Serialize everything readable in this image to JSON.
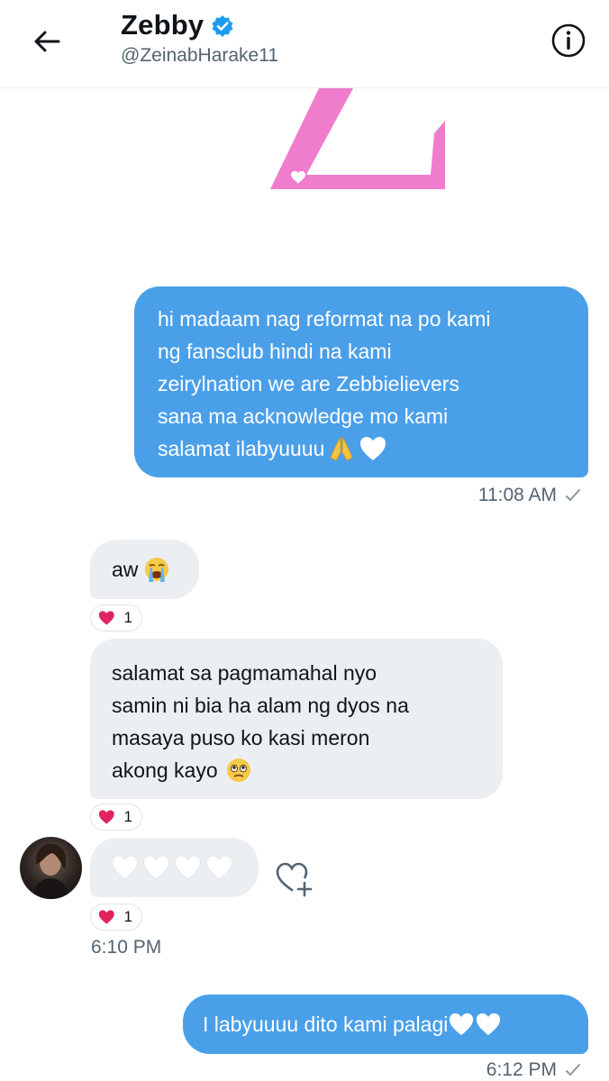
{
  "header": {
    "name": "Zebby",
    "handle": "@ZeinabHarake11",
    "verified": true,
    "icons": [
      "back-arrow-icon",
      "verified-badge-icon",
      "info-icon"
    ]
  },
  "colors": {
    "outgoing_bubble": "#4a9fe9",
    "incoming_bubble": "#eceff2",
    "logo_pink": "#f07ccd",
    "verified_blue": "#1d9bf0",
    "reaction_red": "#e0245e"
  },
  "messages": [
    {
      "direction": "outgoing",
      "lines": [
        "hi madaam nag reformat na po kami",
        "ng fansclub hindi na kami",
        "zeirylnation we are Zebbielievers",
        "sana ma acknowledge mo kami",
        "salamat ilabyuuuu"
      ],
      "emojis": [
        "folded-hands-icon",
        "white-heart-icon"
      ],
      "time": "11:08 AM"
    },
    {
      "direction": "incoming",
      "text": "aw",
      "emojis": [
        "loudly-crying-face-icon"
      ],
      "reaction_count": "1"
    },
    {
      "direction": "incoming",
      "lines": [
        "salamat sa pagmamahal nyo",
        "samin ni bia ha alam ng dyos na",
        "masaya puso ko kasi meron",
        "akong kayo"
      ],
      "emojis": [
        "face-holding-back-tears-icon"
      ],
      "reaction_count": "1"
    },
    {
      "direction": "incoming",
      "emojis": [
        "white-heart-icon",
        "white-heart-icon",
        "white-heart-icon",
        "white-heart-icon"
      ],
      "reaction_count": "1",
      "time": "6:10 PM"
    },
    {
      "direction": "outgoing",
      "text": "I labyuuuu dito kami palagi",
      "emojis": [
        "white-heart-icon",
        "white-heart-icon"
      ],
      "time": "6:12 PM"
    }
  ]
}
